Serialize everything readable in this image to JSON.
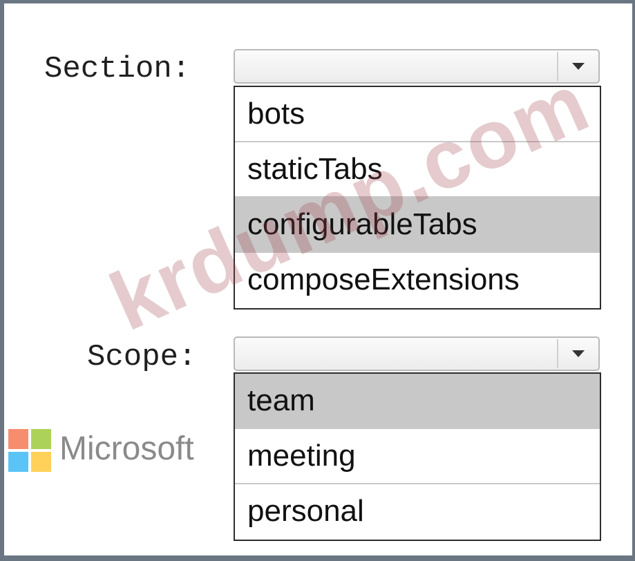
{
  "section": {
    "label": "Section:",
    "selected_value": "",
    "options": [
      "bots",
      "staticTabs",
      "configurableTabs",
      "composeExtensions"
    ],
    "highlighted": "configurableTabs"
  },
  "scope": {
    "label": "Scope:",
    "selected_value": "",
    "options": [
      "team",
      "meeting",
      "personal"
    ],
    "highlighted": "team"
  },
  "watermark": {
    "text": "krdump.com"
  },
  "brand": {
    "text": "Microsoft",
    "logo_colors": [
      "#f25022",
      "#7fba00",
      "#00a4ef",
      "#ffb900"
    ]
  },
  "icons": {
    "dropdown": "chevron-down-icon"
  },
  "colors": {
    "frame": "#6b7683",
    "highlight": "#c8c8c8"
  }
}
